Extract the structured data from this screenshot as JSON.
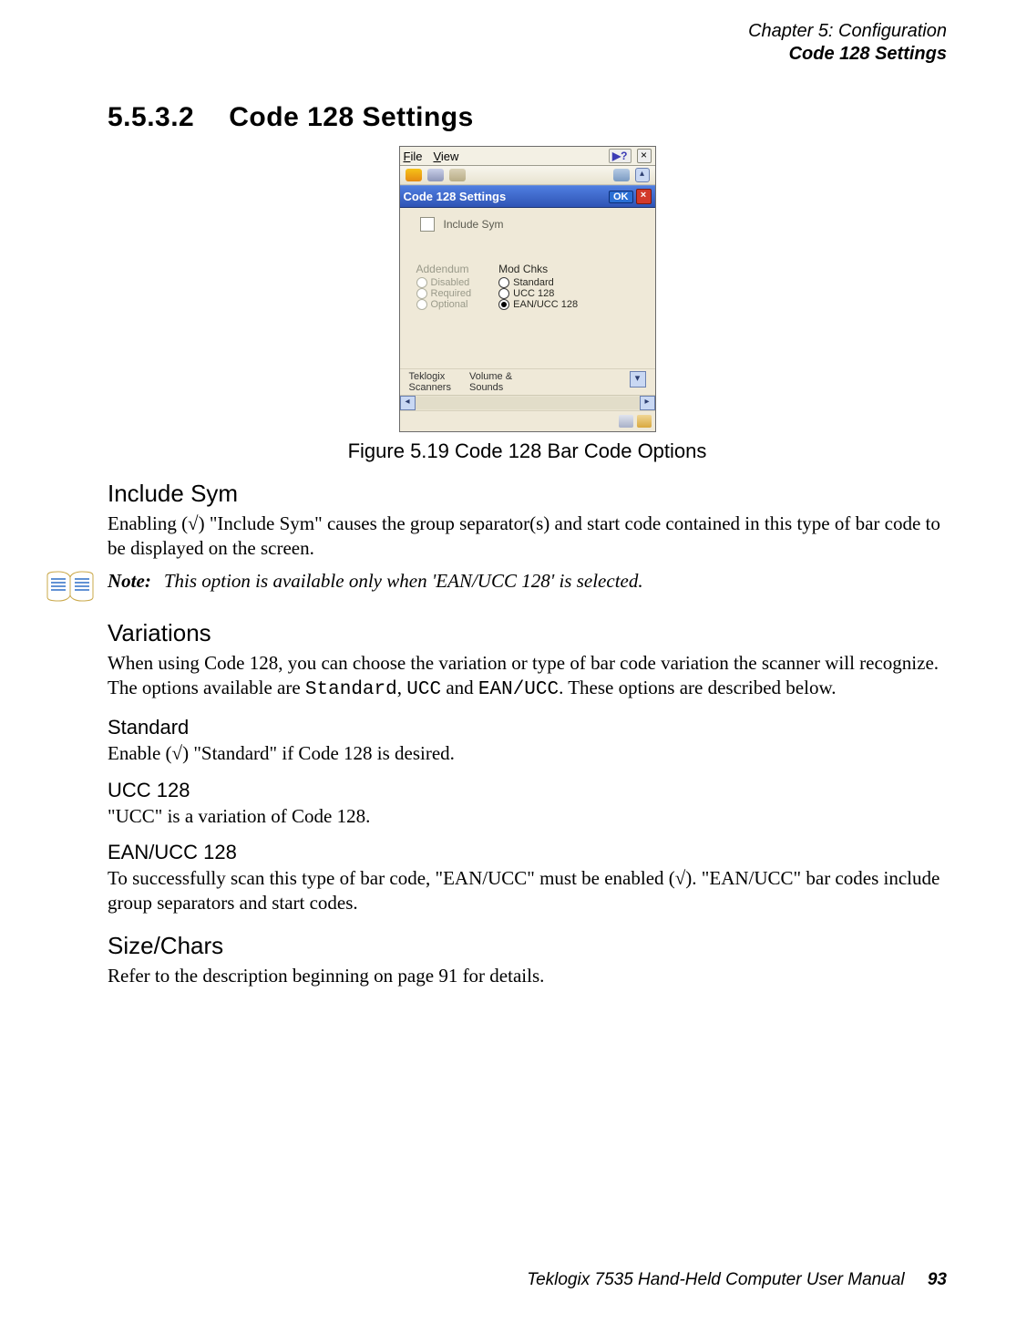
{
  "header": {
    "chapter": "Chapter 5: Configuration",
    "section": "Code 128 Settings"
  },
  "title": {
    "number": "5.5.3.2",
    "text": "Code 128 Settings"
  },
  "screenshot": {
    "menu_file": "File",
    "menu_view": "View",
    "help_icon": "help-arrow-icon",
    "close_icon": "close-icon",
    "window_title": "Code 128 Settings",
    "ok_label": "OK",
    "red_close_icon": "close-icon",
    "checkbox_label": "Include Sym",
    "group_left_head": "Addendum",
    "group_left_opts": [
      "Disabled",
      "Required",
      "Optional"
    ],
    "group_right_head": "Mod Chks",
    "group_right_opts": [
      "Standard",
      "UCC 128",
      "EAN/UCC 128"
    ],
    "group_right_selected_index": 2,
    "foot_left_top": "Teklogix",
    "foot_left_bot": "Scanners",
    "foot_right_top": "Volume &",
    "foot_right_bot": "Sounds"
  },
  "figure_caption": "Figure 5.19 Code 128 Bar Code Options",
  "include_sym": {
    "head": "Include Sym",
    "body": "Enabling (√) \"Include Sym\" causes the group separator(s) and start code contained in this type of bar code to be displayed on the screen."
  },
  "note": {
    "label": "Note:",
    "body": "This option is available only when 'EAN/UCC 128' is selected."
  },
  "variations": {
    "head": "Variations",
    "body_pre": "When using Code 128, you can choose the variation or type of bar code variation the scanner will recognize. The options available are ",
    "opt1": "Standard",
    "sep1": ", ",
    "opt2": "UCC",
    "mid": " and ",
    "opt3": "EAN/UCC",
    "body_post": ". These options are described below."
  },
  "standard": {
    "head": "Standard",
    "body": "Enable (√) \"Standard\" if Code 128 is desired."
  },
  "ucc128": {
    "head": "UCC 128",
    "body": "\"UCC\" is a variation of Code 128."
  },
  "eanucc128": {
    "head": "EAN/UCC 128",
    "body": "To successfully scan this type of bar code, \"EAN/UCC\" must be enabled (√). \"EAN/UCC\" bar codes include group separators and start codes."
  },
  "sizechars": {
    "head": "Size/Chars",
    "body": "Refer to the description beginning on page 91 for details."
  },
  "footer": {
    "manual": "Teklogix 7535 Hand-Held Computer User Manual",
    "page": "93"
  }
}
